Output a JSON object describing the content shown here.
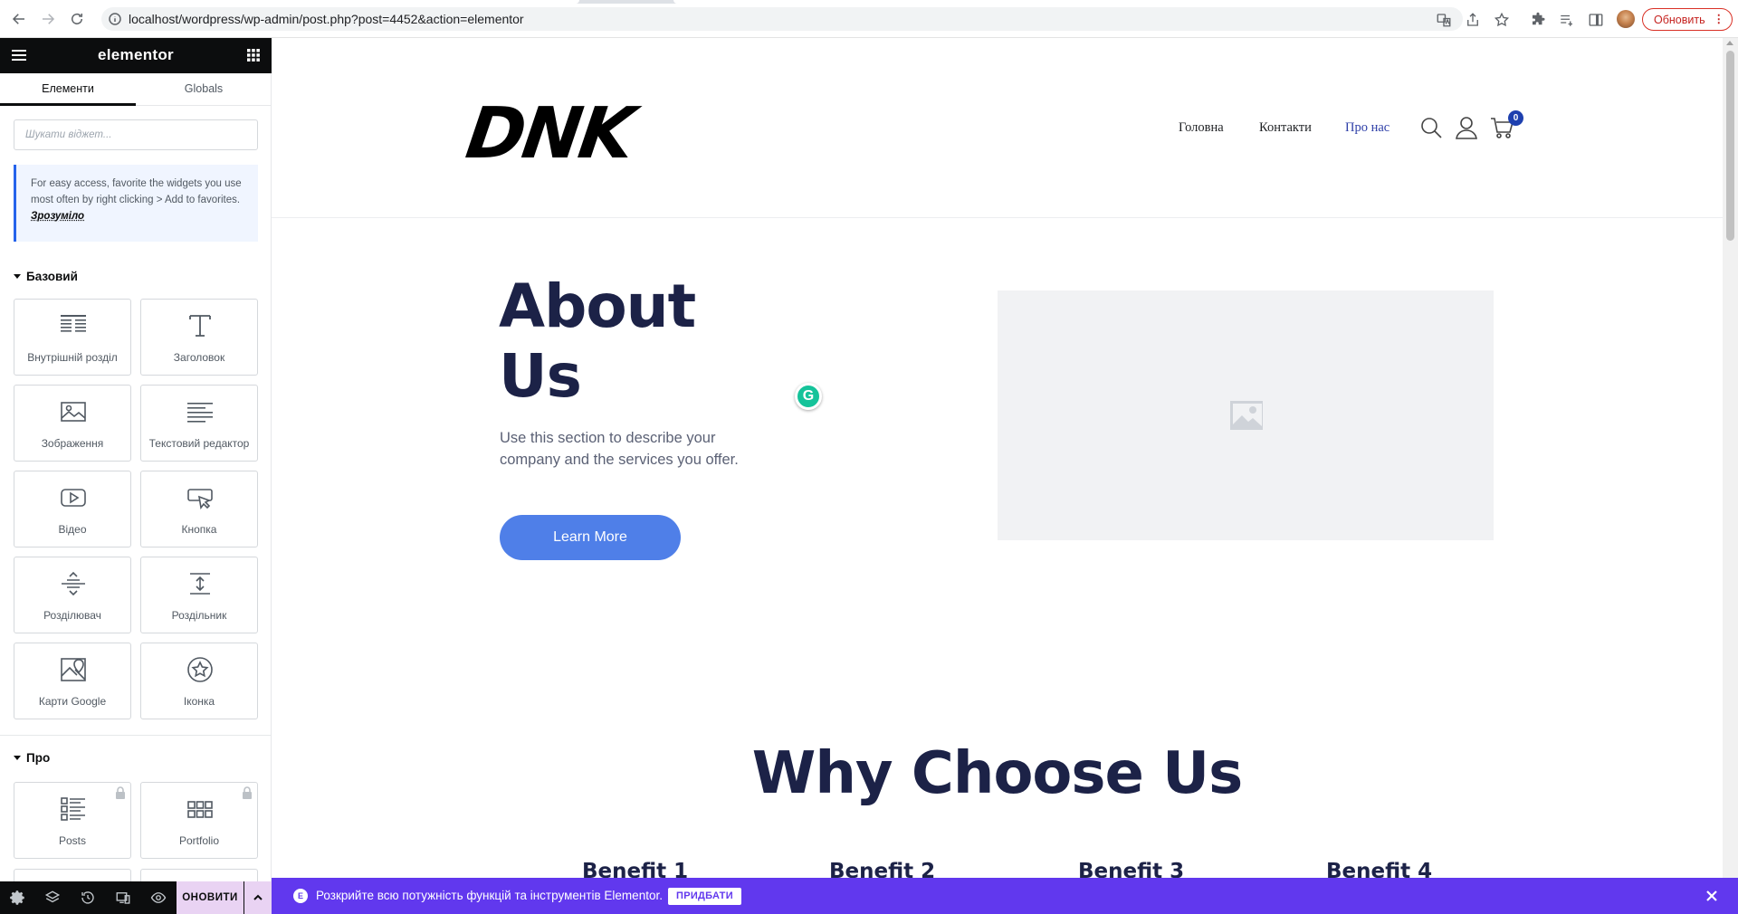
{
  "browser": {
    "url": "localhost/wordpress/wp-admin/post.php?post=4452&action=elementor",
    "update_label": "Обновить"
  },
  "panel": {
    "logo": "elementor",
    "tabs": [
      "Елементи",
      "Globals"
    ],
    "search_placeholder": "Шукати віджет...",
    "notice_text": "For easy access, favorite the widgets you use most often by right clicking > Add to favorites.",
    "notice_link": "Зрозуміло",
    "category_basic": "Базовий",
    "basic_widgets": [
      {
        "label": "Внутрішній розділ",
        "icon": "inner-section-icon"
      },
      {
        "label": "Заголовок",
        "icon": "heading-icon"
      },
      {
        "label": "Зображення",
        "icon": "image-icon"
      },
      {
        "label": "Текстовий редактор",
        "icon": "text-editor-icon"
      },
      {
        "label": "Відео",
        "icon": "video-icon"
      },
      {
        "label": "Кнопка",
        "icon": "button-icon"
      },
      {
        "label": "Розділювач",
        "icon": "divider-icon"
      },
      {
        "label": "Роздільник",
        "icon": "spacer-icon"
      },
      {
        "label": "Карти Google",
        "icon": "google-maps-icon"
      },
      {
        "label": "Іконка",
        "icon": "star-icon"
      }
    ],
    "category_pro": "Про",
    "pro_widgets": [
      {
        "label": "Posts",
        "icon": "posts-icon"
      },
      {
        "label": "Portfolio",
        "icon": "portfolio-icon"
      }
    ],
    "footer_update": "ОНОВИТИ"
  },
  "site": {
    "logo_text": "DNK",
    "nav": [
      "Головна",
      "Контакти",
      "Про нас"
    ],
    "cart_count": "0",
    "about_title_line1": "About",
    "about_title_line2": "Us",
    "about_text": "Use this section to describe your company and the services you offer.",
    "learn_more": "Learn More",
    "why_title": "Why Choose Us",
    "benefits": [
      "Benefit 1",
      "Benefit 2",
      "Benefit 3",
      "Benefit 4"
    ]
  },
  "promo": {
    "text": "Розкрийте всю потужність функцій та інструментів Elementor.",
    "button": "ПРИДБАТИ"
  },
  "colors": {
    "accent": "#6138ee",
    "heading": "#1c2247",
    "button": "#4f7fe8",
    "nav_active": "#2e3fa8",
    "panel_header": "#0c0d0e"
  }
}
